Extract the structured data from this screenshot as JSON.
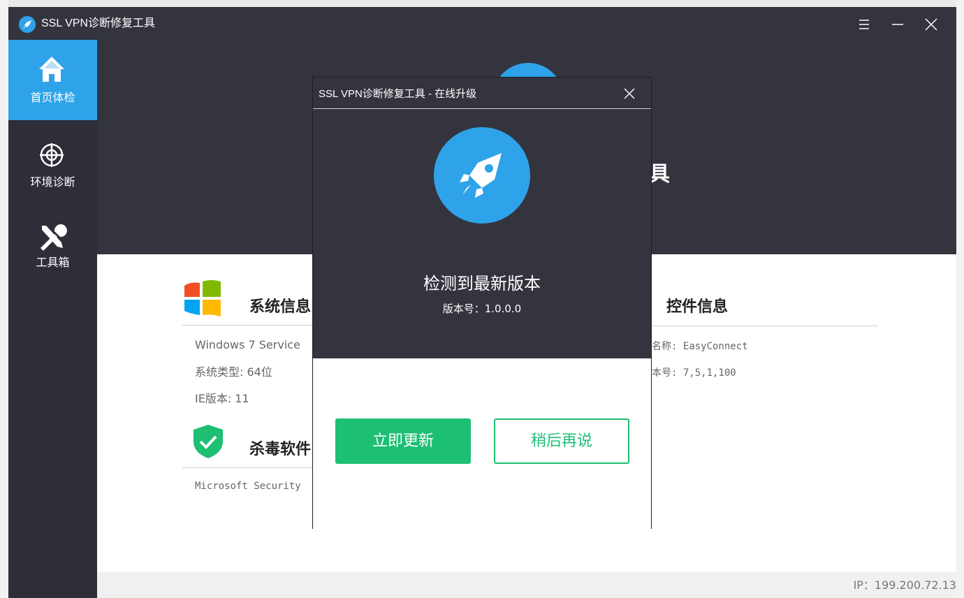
{
  "app": {
    "title": "SSL VPN诊断修复工具"
  },
  "colors": {
    "accent": "#2ea3e9",
    "success": "#1dbf73",
    "dark_bg": "#34343f",
    "sidebar_bg": "#2e2e39"
  },
  "titlebar": {
    "icons": [
      "menu-icon",
      "minimize-icon",
      "close-icon"
    ]
  },
  "sidebar": {
    "items": [
      {
        "label": "首页体检",
        "icon": "home-icon",
        "active": true
      },
      {
        "label": "环境诊断",
        "icon": "crosshair-icon",
        "active": false
      },
      {
        "label": "工具箱",
        "icon": "tools-icon",
        "active": false
      }
    ]
  },
  "hero": {
    "title_tail": "具"
  },
  "sections": {
    "system": {
      "title": "系统信息",
      "icon": "windows-logo-icon",
      "lines": [
        "Windows 7 Service",
        "系统类型: 64位",
        "IE版本: 11"
      ]
    },
    "antivirus": {
      "title": "杀毒软件",
      "icon": "shield-check-icon",
      "lines": [
        "Microsoft Security"
      ]
    },
    "control": {
      "title": "控件信息",
      "lines": [
        "名称: EasyConnect",
        "本号: 7,5,1,100"
      ]
    }
  },
  "status_bar": {
    "ip": "IP：199.200.72.13"
  },
  "dialog": {
    "title": "SSL VPN诊断修复工具 - 在线升级",
    "icon": "rocket-icon",
    "heading": "检测到最新版本",
    "version": "版本号：1.0.0.0",
    "update_now": "立即更新",
    "later": "稍后再说"
  }
}
